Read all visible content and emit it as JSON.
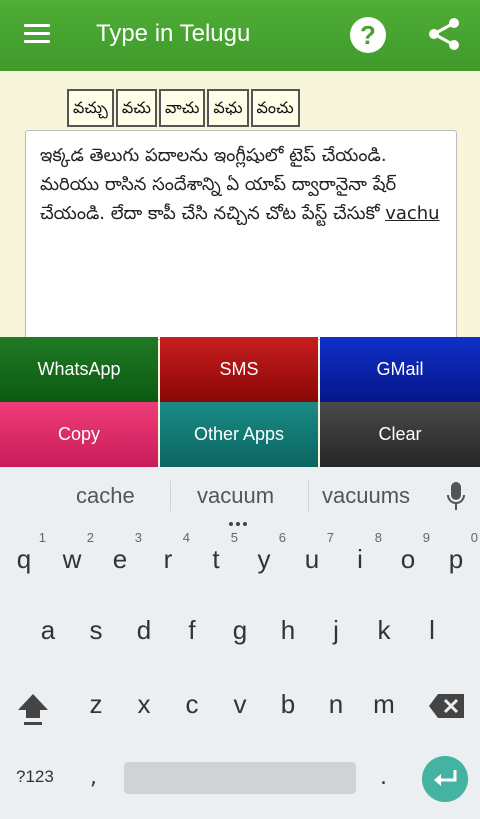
{
  "appbar": {
    "title": "Type in Telugu",
    "help_glyph": "?"
  },
  "suggestions": [
    "వచ్చు",
    "వచు",
    "వాచు",
    "వఛు",
    "వంచు"
  ],
  "text_area": {
    "telugu": "ఇక్కడ తెలుగు పదాలను ఇంగ్లీషులో టైప్ చేయండి. మరియు రాసిన సందేశాన్ని ఏ యాప్ ద్వారానైనా షేర్ చేయండి. లేదా కాపీ చేసి నచ్చిన చోట పేస్ట్ చేసుకో ",
    "typed": "vachu"
  },
  "buttons": {
    "whatsapp": "WhatsApp",
    "sms": "SMS",
    "gmail": "GMail",
    "copy": "Copy",
    "other_apps": "Other Apps",
    "clear": "Clear"
  },
  "keyboard": {
    "suggestions": [
      "cache",
      "vacuum",
      "vacuums"
    ],
    "row1": [
      {
        "k": "q",
        "n": "1"
      },
      {
        "k": "w",
        "n": "2"
      },
      {
        "k": "e",
        "n": "3"
      },
      {
        "k": "r",
        "n": "4"
      },
      {
        "k": "t",
        "n": "5"
      },
      {
        "k": "y",
        "n": "6"
      },
      {
        "k": "u",
        "n": "7"
      },
      {
        "k": "i",
        "n": "8"
      },
      {
        "k": "o",
        "n": "9"
      },
      {
        "k": "p",
        "n": "0"
      }
    ],
    "row2": [
      "a",
      "s",
      "d",
      "f",
      "g",
      "h",
      "j",
      "k",
      "l"
    ],
    "row3": [
      "z",
      "x",
      "c",
      "v",
      "b",
      "n",
      "m"
    ],
    "symbols": "?123",
    "comma": ",",
    "period": "."
  }
}
